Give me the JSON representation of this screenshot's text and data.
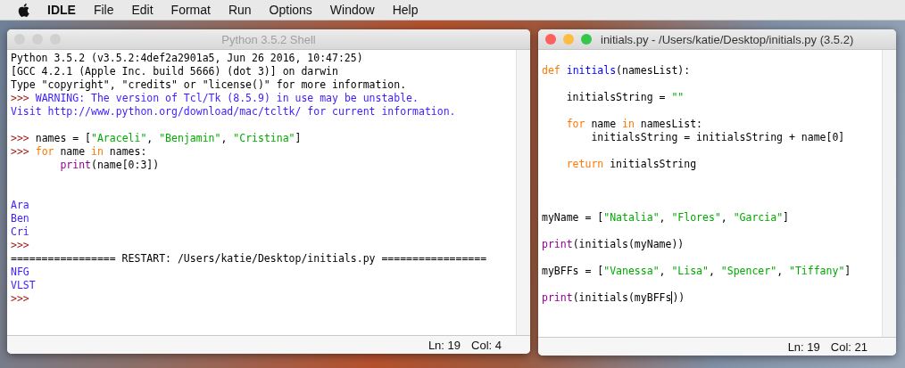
{
  "menu_bar": {
    "app": "IDLE",
    "items": [
      "File",
      "Edit",
      "Format",
      "Run",
      "Options",
      "Window",
      "Help"
    ]
  },
  "windows": [
    {
      "title": "Python 3.5.2 Shell",
      "active": false,
      "status": {
        "line": "Ln: 19",
        "column": "Col: 4"
      },
      "lines": [
        {
          "kind": "code",
          "tokens": [
            {
              "kind": "normal",
              "text": "Python 3.5.2 (v3.5.2:4def2a2901a5, Jun 26 2016, 10:47:25)"
            }
          ]
        },
        {
          "kind": "code",
          "tokens": [
            {
              "kind": "normal",
              "text": "[GCC 4.2.1 (Apple Inc. build 5666) (dot 3)] on darwin"
            }
          ]
        },
        {
          "kind": "code",
          "tokens": [
            {
              "kind": "normal",
              "text": "Type \"copyright\", \"credits\" or \"license()\" for more information."
            }
          ]
        },
        {
          "kind": "code",
          "tokens": [
            {
              "kind": "prompt",
              "text": ">>> "
            },
            {
              "kind": "output",
              "text": "WARNING: The version of Tcl/Tk (8.5.9) in use may be unstable."
            }
          ]
        },
        {
          "kind": "code",
          "tokens": [
            {
              "kind": "output",
              "text": "Visit http://www.python.org/download/mac/tcltk/ for current information."
            }
          ]
        },
        {
          "kind": "blank"
        },
        {
          "kind": "code",
          "tokens": [
            {
              "kind": "prompt",
              "text": ">>> "
            },
            {
              "kind": "normal",
              "text": "names = ["
            },
            {
              "kind": "string",
              "text": "\"Araceli\""
            },
            {
              "kind": "normal",
              "text": ", "
            },
            {
              "kind": "string",
              "text": "\"Benjamin\""
            },
            {
              "kind": "normal",
              "text": ", "
            },
            {
              "kind": "string",
              "text": "\"Cristina\""
            },
            {
              "kind": "normal",
              "text": "]"
            }
          ]
        },
        {
          "kind": "code",
          "tokens": [
            {
              "kind": "prompt",
              "text": ">>> "
            },
            {
              "kind": "keyword",
              "text": "for"
            },
            {
              "kind": "normal",
              "text": " name "
            },
            {
              "kind": "keyword",
              "text": "in"
            },
            {
              "kind": "normal",
              "text": " names:"
            }
          ]
        },
        {
          "kind": "code",
          "tokens": [
            {
              "kind": "builtin",
              "text": "        print"
            },
            {
              "kind": "normal",
              "text": "(name[0:3])"
            }
          ]
        },
        {
          "kind": "blank"
        },
        {
          "kind": "blank"
        },
        {
          "kind": "code",
          "tokens": [
            {
              "kind": "output",
              "text": "Ara"
            }
          ]
        },
        {
          "kind": "code",
          "tokens": [
            {
              "kind": "output",
              "text": "Ben"
            }
          ]
        },
        {
          "kind": "code",
          "tokens": [
            {
              "kind": "output",
              "text": "Cri"
            }
          ]
        },
        {
          "kind": "code",
          "tokens": [
            {
              "kind": "prompt",
              "text": ">>>"
            }
          ]
        },
        {
          "kind": "code",
          "tokens": [
            {
              "kind": "normal",
              "text": "================= RESTART: /Users/katie/Desktop/initials.py ================="
            }
          ]
        },
        {
          "kind": "code",
          "tokens": [
            {
              "kind": "output",
              "text": "NFG"
            }
          ]
        },
        {
          "kind": "code",
          "tokens": [
            {
              "kind": "output",
              "text": "VLST"
            }
          ]
        },
        {
          "kind": "code",
          "tokens": [
            {
              "kind": "prompt",
              "text": ">>>"
            }
          ]
        }
      ]
    },
    {
      "title": "initials.py - /Users/katie/Desktop/initials.py (3.5.2)",
      "active": true,
      "status": {
        "line": "Ln: 19",
        "column": "Col: 21"
      },
      "lines": [
        {
          "kind": "code",
          "tokens": [
            {
              "kind": "keyword",
              "text": "def"
            },
            {
              "kind": "definition",
              "text": " initials"
            },
            {
              "kind": "normal",
              "text": "(namesList):"
            }
          ]
        },
        {
          "kind": "blank"
        },
        {
          "kind": "code",
          "tokens": [
            {
              "kind": "normal",
              "text": "    initialsString = "
            },
            {
              "kind": "string",
              "text": "\"\""
            }
          ]
        },
        {
          "kind": "blank"
        },
        {
          "kind": "code",
          "tokens": [
            {
              "kind": "keyword",
              "text": "    for"
            },
            {
              "kind": "normal",
              "text": " name "
            },
            {
              "kind": "keyword",
              "text": "in"
            },
            {
              "kind": "normal",
              "text": " namesList:"
            }
          ]
        },
        {
          "kind": "code",
          "tokens": [
            {
              "kind": "normal",
              "text": "        initialsString = initialsString + name[0]"
            }
          ]
        },
        {
          "kind": "blank"
        },
        {
          "kind": "code",
          "tokens": [
            {
              "kind": "keyword",
              "text": "    return"
            },
            {
              "kind": "normal",
              "text": " initialsString"
            }
          ]
        },
        {
          "kind": "blank"
        },
        {
          "kind": "blank"
        },
        {
          "kind": "blank"
        },
        {
          "kind": "code",
          "tokens": [
            {
              "kind": "normal",
              "text": "myName = ["
            },
            {
              "kind": "string",
              "text": "\"Natalia\""
            },
            {
              "kind": "normal",
              "text": ", "
            },
            {
              "kind": "string",
              "text": "\"Flores\""
            },
            {
              "kind": "normal",
              "text": ", "
            },
            {
              "kind": "string",
              "text": "\"Garcia\""
            },
            {
              "kind": "normal",
              "text": "]"
            }
          ]
        },
        {
          "kind": "blank"
        },
        {
          "kind": "code",
          "tokens": [
            {
              "kind": "builtin",
              "text": "print"
            },
            {
              "kind": "normal",
              "text": "(initials(myName))"
            }
          ]
        },
        {
          "kind": "blank"
        },
        {
          "kind": "code",
          "tokens": [
            {
              "kind": "normal",
              "text": "myBFFs = ["
            },
            {
              "kind": "string",
              "text": "\"Vanessa\""
            },
            {
              "kind": "normal",
              "text": ", "
            },
            {
              "kind": "string",
              "text": "\"Lisa\""
            },
            {
              "kind": "normal",
              "text": ", "
            },
            {
              "kind": "string",
              "text": "\"Spencer\""
            },
            {
              "kind": "normal",
              "text": ", "
            },
            {
              "kind": "string",
              "text": "\"Tiffany\""
            },
            {
              "kind": "normal",
              "text": "]"
            }
          ]
        },
        {
          "kind": "blank"
        },
        {
          "kind": "code",
          "tokens": [
            {
              "kind": "builtin",
              "text": "print"
            },
            {
              "kind": "normal",
              "text": "(initials(myBFFs",
              "cursor_after": true
            },
            {
              "kind": "normal",
              "text": "))"
            }
          ]
        }
      ]
    }
  ]
}
